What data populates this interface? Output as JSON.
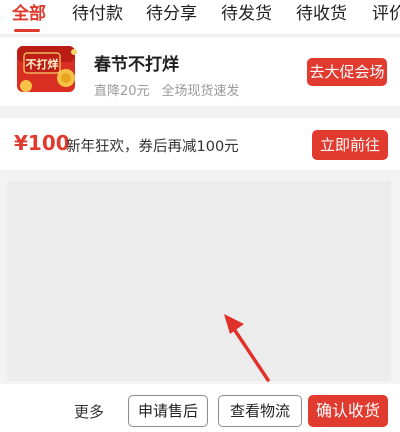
{
  "tabs": [
    {
      "label": "全部",
      "active": true
    },
    {
      "label": "待付款"
    },
    {
      "label": "待分享"
    },
    {
      "label": "待发货"
    },
    {
      "label": "待收货"
    },
    {
      "label": "评价"
    }
  ],
  "promo": {
    "badge_text": "不打烊",
    "title": "春节不打烊",
    "subtitle_1": "直降20元",
    "subtitle_2": "全场现货速发",
    "button_label": "去大促会场"
  },
  "coupon": {
    "amount": "¥100",
    "description": "新年狂欢，券后再减100元",
    "button_label": "立即前往"
  },
  "action_bar": {
    "more_label": "更多",
    "after_sales_label": "申请售后",
    "logistics_label": "查看物流",
    "confirm_label": "确认收货"
  },
  "colors": {
    "accent": "#e13a2f"
  }
}
